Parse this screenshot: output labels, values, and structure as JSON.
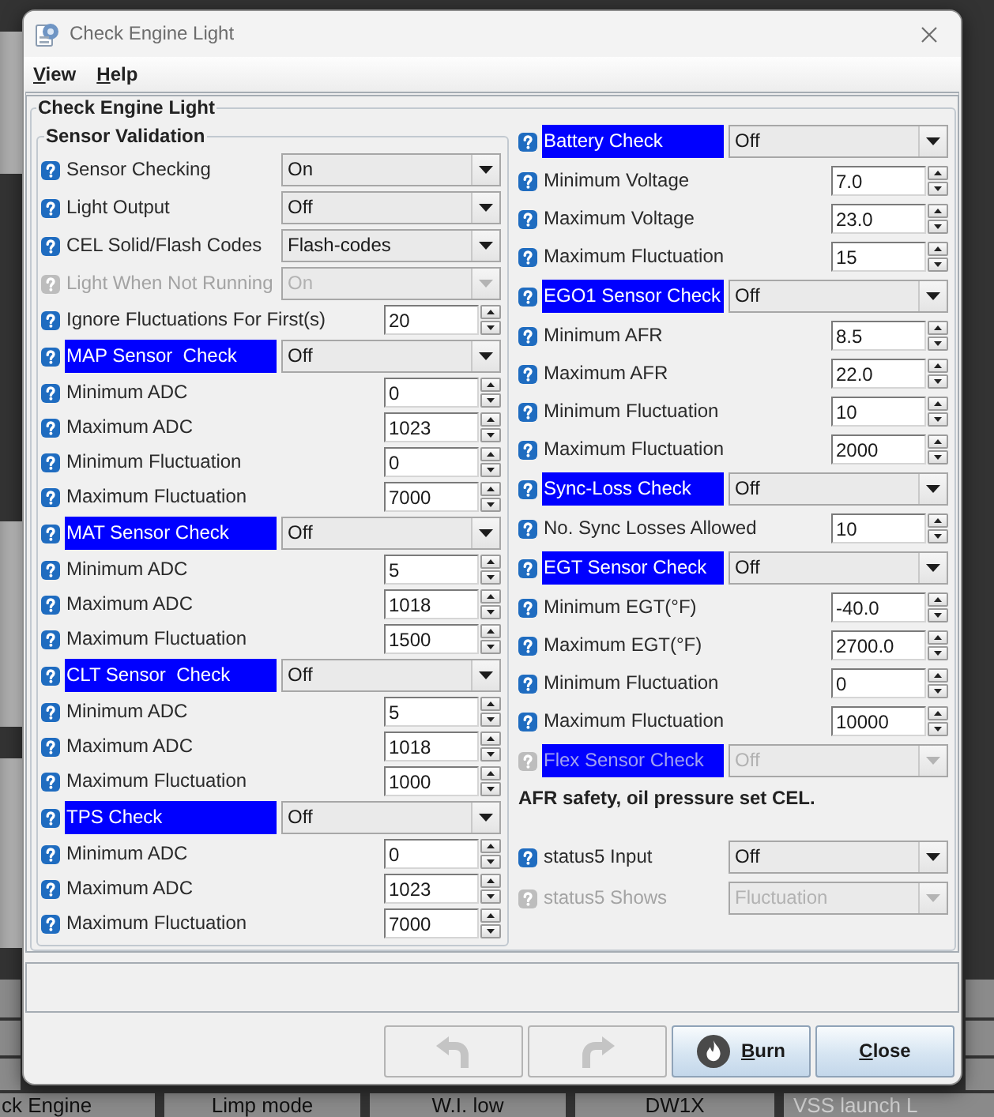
{
  "window": {
    "title": "Check Engine Light"
  },
  "menu": [
    {
      "label": "View"
    },
    {
      "label": "Help"
    }
  ],
  "panel": {
    "title": "Check Engine Light",
    "sensor_validation": {
      "title": "Sensor Validation",
      "rows": [
        {
          "kind": "combo",
          "label": "Sensor Checking",
          "value": "On",
          "highlighted": false,
          "disabled": false
        },
        {
          "kind": "combo",
          "label": "Light Output",
          "value": "Off",
          "highlighted": false,
          "disabled": false
        },
        {
          "kind": "combo",
          "label": "CEL Solid/Flash Codes",
          "value": "Flash-codes",
          "highlighted": false,
          "disabled": false
        },
        {
          "kind": "combo",
          "label": "Light When Not Running",
          "value": "On",
          "highlighted": false,
          "disabled": true
        },
        {
          "kind": "spinner",
          "label": "Ignore Fluctuations For First(s)",
          "value": "20",
          "highlighted": false,
          "disabled": false
        },
        {
          "kind": "combo",
          "label": "MAP Sensor  Check",
          "value": "Off",
          "highlighted": true,
          "disabled": false
        },
        {
          "kind": "spinner",
          "label": "Minimum ADC",
          "value": "0",
          "highlighted": false,
          "disabled": false
        },
        {
          "kind": "spinner",
          "label": "Maximum ADC",
          "value": "1023",
          "highlighted": false,
          "disabled": false
        },
        {
          "kind": "spinner",
          "label": "Minimum Fluctuation",
          "value": "0",
          "highlighted": false,
          "disabled": false
        },
        {
          "kind": "spinner",
          "label": "Maximum Fluctuation",
          "value": "7000",
          "highlighted": false,
          "disabled": false
        },
        {
          "kind": "combo",
          "label": "MAT Sensor Check",
          "value": "Off",
          "highlighted": true,
          "disabled": false
        },
        {
          "kind": "spinner",
          "label": "Minimum ADC",
          "value": "5",
          "highlighted": false,
          "disabled": false
        },
        {
          "kind": "spinner",
          "label": "Maximum ADC",
          "value": "1018",
          "highlighted": false,
          "disabled": false
        },
        {
          "kind": "spinner",
          "label": "Maximum Fluctuation",
          "value": "1500",
          "highlighted": false,
          "disabled": false
        },
        {
          "kind": "combo",
          "label": "CLT Sensor  Check",
          "value": "Off",
          "highlighted": true,
          "disabled": false
        },
        {
          "kind": "spinner",
          "label": "Minimum ADC",
          "value": "5",
          "highlighted": false,
          "disabled": false
        },
        {
          "kind": "spinner",
          "label": "Maximum ADC",
          "value": "1018",
          "highlighted": false,
          "disabled": false
        },
        {
          "kind": "spinner",
          "label": "Maximum Fluctuation",
          "value": "1000",
          "highlighted": false,
          "disabled": false
        },
        {
          "kind": "combo",
          "label": "TPS Check",
          "value": "Off",
          "highlighted": true,
          "disabled": false
        },
        {
          "kind": "spinner",
          "label": "Minimum ADC",
          "value": "0",
          "highlighted": false,
          "disabled": false
        },
        {
          "kind": "spinner",
          "label": "Maximum ADC",
          "value": "1023",
          "highlighted": false,
          "disabled": false
        },
        {
          "kind": "spinner",
          "label": "Maximum Fluctuation",
          "value": "7000",
          "highlighted": false,
          "disabled": false
        }
      ]
    },
    "right_rows": [
      {
        "kind": "combo",
        "label": "Battery Check",
        "value": "Off",
        "highlighted": true,
        "disabled": false
      },
      {
        "kind": "spinner",
        "label": "Minimum Voltage",
        "value": "7.0",
        "highlighted": false,
        "disabled": false
      },
      {
        "kind": "spinner",
        "label": "Maximum Voltage",
        "value": "23.0",
        "highlighted": false,
        "disabled": false
      },
      {
        "kind": "spinner",
        "label": "Maximum Fluctuation",
        "value": "15",
        "highlighted": false,
        "disabled": false
      },
      {
        "kind": "combo",
        "label": "EGO1 Sensor Check",
        "value": "Off",
        "highlighted": true,
        "disabled": false
      },
      {
        "kind": "spinner",
        "label": "Minimum AFR",
        "value": "8.5",
        "highlighted": false,
        "disabled": false
      },
      {
        "kind": "spinner",
        "label": "Maximum AFR",
        "value": "22.0",
        "highlighted": false,
        "disabled": false
      },
      {
        "kind": "spinner",
        "label": "Minimum Fluctuation",
        "value": "10",
        "highlighted": false,
        "disabled": false
      },
      {
        "kind": "spinner",
        "label": "Maximum Fluctuation",
        "value": "2000",
        "highlighted": false,
        "disabled": false
      },
      {
        "kind": "combo",
        "label": "Sync-Loss Check",
        "value": "Off",
        "highlighted": true,
        "disabled": false
      },
      {
        "kind": "spinner",
        "label": "No. Sync Losses Allowed",
        "value": "10",
        "highlighted": false,
        "disabled": false
      },
      {
        "kind": "combo",
        "label": "EGT Sensor Check",
        "value": "Off",
        "highlighted": true,
        "disabled": false
      },
      {
        "kind": "spinner",
        "label": "Minimum EGT(°F)",
        "value": "-40.0",
        "highlighted": false,
        "disabled": false
      },
      {
        "kind": "spinner",
        "label": "Maximum EGT(°F)",
        "value": "2700.0",
        "highlighted": false,
        "disabled": false
      },
      {
        "kind": "spinner",
        "label": "Minimum Fluctuation",
        "value": "0",
        "highlighted": false,
        "disabled": false
      },
      {
        "kind": "spinner",
        "label": "Maximum Fluctuation",
        "value": "10000",
        "highlighted": false,
        "disabled": false
      },
      {
        "kind": "combo",
        "label": "Flex Sensor Check",
        "value": "Off",
        "highlighted": true,
        "disabled": true
      },
      {
        "kind": "note",
        "text": "AFR safety, oil pressure set CEL."
      },
      {
        "kind": "combo",
        "label": "status5 Input",
        "value": "Off",
        "highlighted": false,
        "disabled": false
      },
      {
        "kind": "combo",
        "label": "status5 Shows",
        "value": "Fluctuation",
        "highlighted": false,
        "disabled": true
      }
    ]
  },
  "buttons": [
    {
      "kind": "undo",
      "disabled": true
    },
    {
      "kind": "redo",
      "disabled": true
    },
    {
      "kind": "burn",
      "label": "Burn",
      "disabled": false
    },
    {
      "kind": "close",
      "label": "Close",
      "disabled": false
    }
  ],
  "indicators": [
    {
      "label": "ck Engine",
      "dimmed": false
    },
    {
      "label": "Limp mode",
      "dimmed": false
    },
    {
      "label": "W.I. low",
      "dimmed": false
    },
    {
      "label": "DW1X",
      "dimmed": false
    },
    {
      "label": "VSS launch L",
      "dimmed": true
    }
  ]
}
